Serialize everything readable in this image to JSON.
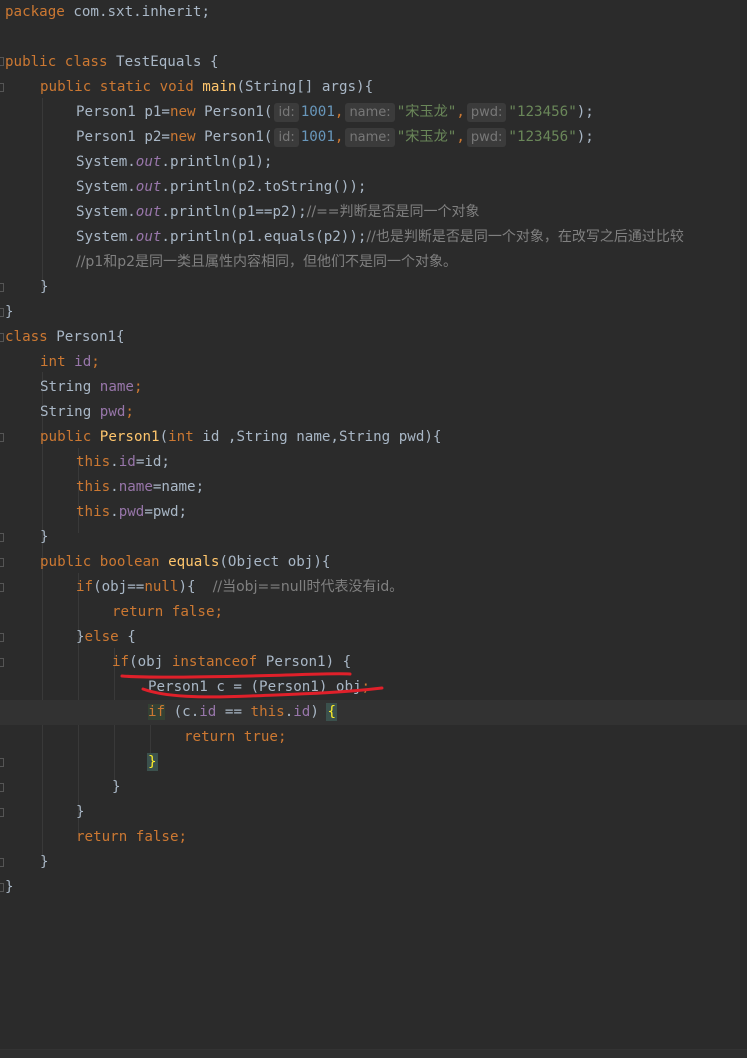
{
  "code": {
    "package_kw": "package",
    "package_name": " com.sxt.inherit;",
    "l1": {
      "kw1": "public",
      "kw2": " class",
      "rest": " TestEquals {"
    },
    "l2": {
      "kw": "public static void",
      "fn": " main",
      "rest": "(String[] args){"
    },
    "l3": {
      "decl": "Person1 p1=",
      "new": "new",
      "ctor": " Person1(",
      "hint_id": "id:",
      "id_val": "1001",
      "hint_name": "name:",
      "name_val": "\"宋玉龙\"",
      "hint_pwd": "pwd:",
      "pwd_val": "\"123456\"",
      "end": ");"
    },
    "l4": {
      "decl": "Person1 p2=",
      "new": "new",
      "ctor": " Person1(",
      "hint_id": "id:",
      "id_val": "1001",
      "hint_name": "name:",
      "name_val": "\"宋玉龙\"",
      "hint_pwd": "pwd:",
      "pwd_val": "\"123456\"",
      "end": ");"
    },
    "l5": {
      "pre": "System.",
      "out": "out",
      "post": ".println(p1);"
    },
    "l6": {
      "pre": "System.",
      "out": "out",
      "post": ".println(p2.toString());"
    },
    "l7": {
      "pre": "System.",
      "out": "out",
      "post": ".println(p1==p2);",
      "comment": "//==判断是否是同一个对象"
    },
    "l8": {
      "pre": "System.",
      "out": "out",
      "post": ".println(p1.equals(p2));",
      "comment": "//也是判断是否是同一个对象，在改写之后通过比较"
    },
    "l9": {
      "comment": "//p1和p2是同一类且属性内容相同，但他们不是同一个对象。"
    },
    "l10": "}",
    "l11": "}",
    "l12": {
      "kw": "class",
      "rest": " Person1{"
    },
    "l13": {
      "kw": "int",
      "fld": " id",
      "semi": ";"
    },
    "l14": {
      "type": "String",
      "fld": " name",
      "semi": ";"
    },
    "l15": {
      "type": "String",
      "fld": " pwd",
      "semi": ";"
    },
    "l16": {
      "kw": "public",
      "fn": " Person1",
      "p1": "(",
      "int": "int",
      "p2": " id ,String name,String pwd){"
    },
    "l17": {
      "this": "this",
      "dot": ".",
      "fld": "id",
      "rest": "=id;"
    },
    "l18": {
      "this": "this",
      "dot": ".",
      "fld": "name",
      "rest": "=name;"
    },
    "l19": {
      "this": "this",
      "dot": ".",
      "fld": "pwd",
      "rest": "=pwd;"
    },
    "l20": "}",
    "l21": {
      "kw": "public boolean",
      "fn": " equals",
      "rest": "(Object obj){"
    },
    "l22": {
      "if": "if",
      "a": "(obj==",
      "null": "null",
      "b": "){  ",
      "comment": "//当obj==null时代表没有id。"
    },
    "l23": {
      "ret": "return",
      "false": " false",
      "semi": ";"
    },
    "l24": {
      "a": "}",
      "else": "else",
      "b": " {"
    },
    "l25": {
      "if": "if",
      "a": "(obj ",
      "inst": "instanceof",
      "b": " Person1) {"
    },
    "l26": {
      "text": "Person1 c = (Person1) obj",
      "semi": ";"
    },
    "l27": {
      "if": "if",
      "a": " (c.",
      "fld": "id",
      "b": " == ",
      "this": "this",
      "dot": ".",
      "fld2": "id",
      "c": ") ",
      "brace": "{"
    },
    "l28": {
      "ret": "return",
      "true": " true",
      "semi": ";"
    },
    "l29": "}",
    "l30": "}",
    "l31": "}",
    "l32": {
      "ret": "return",
      "false": " false",
      "semi": ";"
    },
    "l33": "}",
    "l34": "}"
  },
  "colors": {
    "background": "#2b2b2b",
    "keyword": "#cc7832",
    "function": "#ffc66d",
    "field": "#9876aa",
    "string": "#6a8759",
    "number": "#6897bb",
    "comment": "#808080",
    "annotation": "#e0202a"
  }
}
